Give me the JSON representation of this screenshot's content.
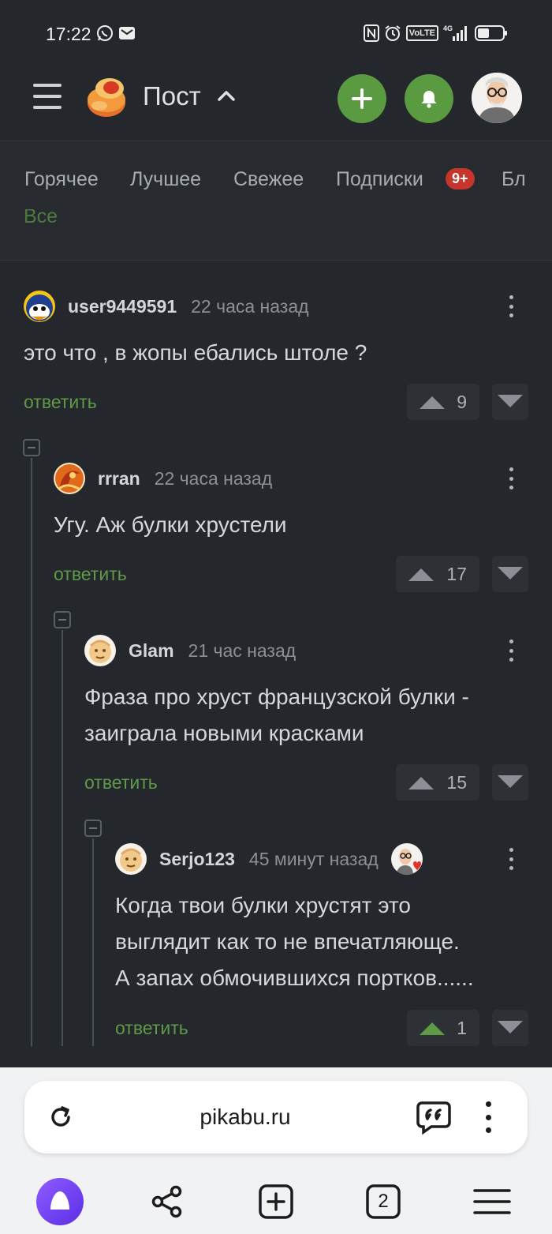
{
  "status_bar": {
    "time": "17:22",
    "left_icons": [
      "whatsapp-icon",
      "mail-icon"
    ],
    "right_icons": [
      "nfc-icon",
      "alarm-icon",
      "volte-icon",
      "signal-4g-icon",
      "battery-icon"
    ],
    "volte_label": "VoLTE",
    "net_label": "4G"
  },
  "header": {
    "title": "Пост",
    "icons": [
      "menu-icon",
      "pikabu-logo",
      "chevron-up-icon",
      "add-icon",
      "bell-icon",
      "avatar"
    ]
  },
  "tabs": {
    "items": [
      "Горячее",
      "Лучшее",
      "Свежее",
      "Подписки",
      "Бл"
    ],
    "subscriptions_badge": "9+"
  },
  "cut_text": "Все",
  "comments": [
    {
      "user": "user9449591",
      "time": "22 часа назад",
      "text": "это что , в жопы ебались штоле ?",
      "reply": "ответить",
      "rating": "9",
      "upvoted": false
    },
    {
      "user": "rrran",
      "time": "22 часа назад",
      "text": "Угу. Аж булки хрустели",
      "reply": "ответить",
      "rating": "17",
      "upvoted": false
    },
    {
      "user": "Glam",
      "time": "21 час назад",
      "text_lines": [
        "Фраза про хруст французской булки -",
        "заиграла новыми красками"
      ],
      "reply": "ответить",
      "rating": "15",
      "upvoted": false
    },
    {
      "user": "Serjo123",
      "time": "45 минут назад",
      "text_lines": [
        "Когда твои булки хрустят это",
        "выглядит как то не впечатляюще.",
        "А запах обмочившихся портков......"
      ],
      "reply": "ответить",
      "rating": "1",
      "upvoted": true
    }
  ],
  "browser": {
    "url": "pikabu.ru",
    "tab_count": "2",
    "icons": [
      "reload-icon",
      "quote-icon",
      "more-vert-icon",
      "alice-icon",
      "share-icon",
      "new-tab-icon",
      "tabs-icon",
      "menu-icon"
    ]
  },
  "colors": {
    "accent_green": "#5a9a40",
    "reply_green": "#5f9a48",
    "background": "#24282c",
    "badge_red": "#c6352b"
  }
}
